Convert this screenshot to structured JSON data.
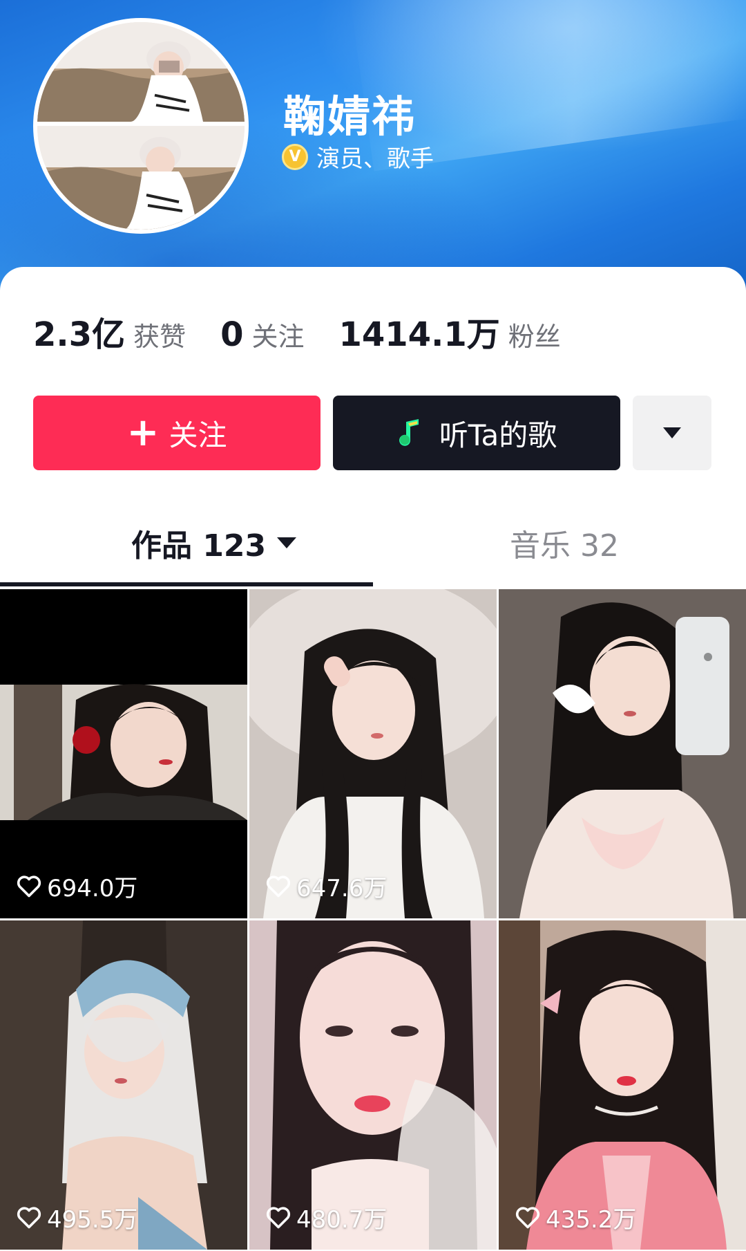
{
  "profile": {
    "name": "鞠婧祎",
    "verify_icon": "v-verified-icon",
    "verify_mark": "V",
    "title": "演员、歌手"
  },
  "stats": [
    {
      "value": "2.3亿",
      "label": "获赞"
    },
    {
      "value": "0",
      "label": "关注"
    },
    {
      "value": "1414.1万",
      "label": "粉丝"
    }
  ],
  "actions": {
    "follow_icon": "plus-icon",
    "follow_plus": "+",
    "follow_label": "关注",
    "music_icon": "music-note-icon",
    "music_label": "听Ta的歌",
    "more_icon": "caret-down-icon"
  },
  "tabs": {
    "works_label": "作品 123",
    "music_label": "音乐 32",
    "active": "works"
  },
  "videos": [
    {
      "likes": "694.0万"
    },
    {
      "likes": "647.6万"
    },
    {
      "likes": ""
    },
    {
      "likes": "495.5万"
    },
    {
      "likes": "480.7万"
    },
    {
      "likes": "435.2万"
    }
  ],
  "colors": {
    "follow_button": "#fe2c55",
    "music_button": "#161823",
    "banner": "#2e8ff0",
    "text_primary": "#161823",
    "text_secondary": "#6f7178"
  }
}
